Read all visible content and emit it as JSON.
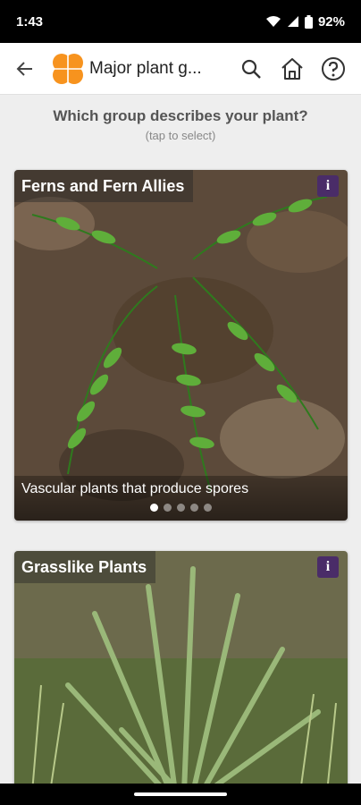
{
  "status": {
    "time": "1:43",
    "battery": "92%"
  },
  "app_bar": {
    "title": "Major plant g..."
  },
  "prompt": {
    "question": "Which group describes your plant?",
    "hint": "(tap to select)"
  },
  "cards": [
    {
      "title": "Ferns and Fern Allies",
      "description": "Vascular plants that produce spores",
      "info": "i",
      "dots": 5,
      "active_dot": 1
    },
    {
      "title": "Grasslike Plants",
      "info": "i"
    }
  ],
  "colors": {
    "accent": "#f7931e",
    "info_badge": "#4a2c68"
  }
}
